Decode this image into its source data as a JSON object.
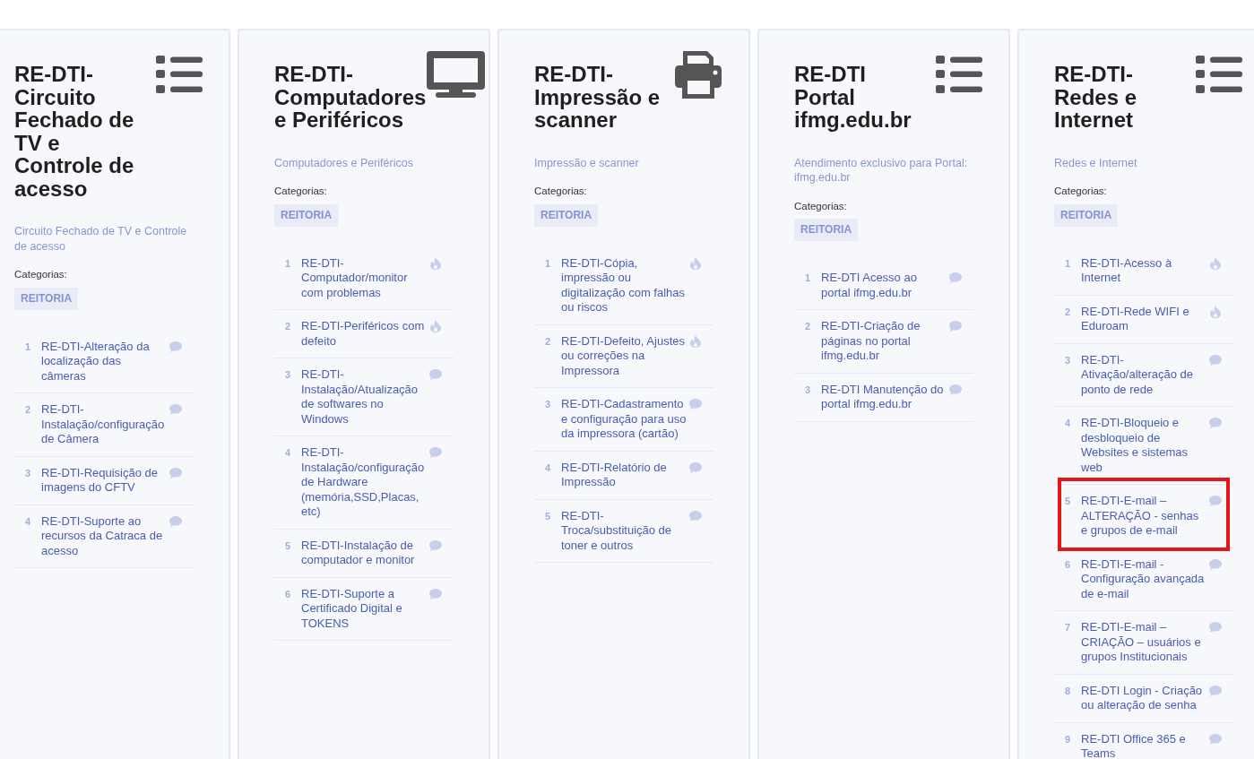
{
  "cards": [
    {
      "kind": "list",
      "title": "RE-DTI-Circuito Fechado de TV e Controle de acesso",
      "description": "Circuito Fechado de TV e Controle de acesso",
      "categories_label": "Categorias:",
      "categories": [
        "REITORIA"
      ],
      "items": [
        {
          "number": "1",
          "title": "RE-DTI-Alteração da localização das câmeras",
          "kind": "comment",
          "highlighted": false
        },
        {
          "number": "2",
          "title": "RE-DTI-Instalação/configuração de Câmera",
          "kind": "comment",
          "highlighted": false
        },
        {
          "number": "3",
          "title": "RE-DTI-Requisição de imagens do CFTV",
          "kind": "comment",
          "highlighted": false
        },
        {
          "number": "4",
          "title": "RE-DTI-Suporte ao recursos da Catraca de acesso",
          "kind": "comment",
          "highlighted": false
        }
      ]
    },
    {
      "kind": "monitor",
      "title": "RE-DTI-Computadores e Periféricos",
      "description": "Computadores e Periféricos",
      "categories_label": "Categorias:",
      "categories": [
        "REITORIA"
      ],
      "items": [
        {
          "number": "1",
          "title": "RE-DTI-Computador/monitor com problemas",
          "kind": "flame",
          "highlighted": false
        },
        {
          "number": "2",
          "title": "RE-DTI-Periféricos com defeito",
          "kind": "flame",
          "highlighted": false
        },
        {
          "number": "3",
          "title": "RE-DTI-Instalação/Atualização de softwares no Windows",
          "kind": "comment",
          "highlighted": false
        },
        {
          "number": "4",
          "title": "RE-DTI-Instalação/configuração de Hardware (memória,SSD,Placas, etc)",
          "kind": "comment",
          "highlighted": false
        },
        {
          "number": "5",
          "title": "RE-DTI-Instalação de computador e monitor",
          "kind": "comment",
          "highlighted": false
        },
        {
          "number": "6",
          "title": "RE-DTI-Suporte a Certificado Digital e TOKENS",
          "kind": "comment",
          "highlighted": false
        }
      ]
    },
    {
      "kind": "printer",
      "title": "RE-DTI-Impressão e scanner",
      "description": "Impressão e scanner",
      "categories_label": "Categorias:",
      "categories": [
        "REITORIA"
      ],
      "items": [
        {
          "number": "1",
          "title": "RE-DTI-Cópia, impressão ou digitalização com falhas ou riscos",
          "kind": "flame",
          "highlighted": false
        },
        {
          "number": "2",
          "title": "RE-DTI-Defeito, Ajustes ou correções na Impressora",
          "kind": "flame",
          "highlighted": false
        },
        {
          "number": "3",
          "title": "RE-DTI-Cadastramento e configuração para uso da impressora (cartão)",
          "kind": "comment",
          "highlighted": false
        },
        {
          "number": "4",
          "title": "RE-DTI-Relatório de Impressão",
          "kind": "comment",
          "highlighted": false
        },
        {
          "number": "5",
          "title": "RE-DTI-Troca/substituição de toner e outros",
          "kind": "comment",
          "highlighted": false
        }
      ]
    },
    {
      "kind": "list",
      "title": "RE-DTI Portal ifmg.edu.br",
      "description": "Atendimento exclusivo para Portal: ifmg.edu.br",
      "categories_label": "Categorias:",
      "categories": [
        "REITORIA"
      ],
      "items": [
        {
          "number": "1",
          "title": "RE-DTI Acesso ao portal ifmg.edu.br",
          "kind": "comment",
          "highlighted": false
        },
        {
          "number": "2",
          "title": "RE-DTI-Criação de páginas no portal ifmg.edu.br",
          "kind": "comment",
          "highlighted": false
        },
        {
          "number": "3",
          "title": "RE-DTI Manutenção do portal ifmg.edu.br",
          "kind": "comment",
          "highlighted": false
        }
      ]
    },
    {
      "kind": "list",
      "title": "RE-DTI-Redes e Internet",
      "description": "Redes e Internet",
      "categories_label": "Categorias:",
      "categories": [
        "REITORIA"
      ],
      "items": [
        {
          "number": "1",
          "title": "RE-DTI-Acesso à Internet",
          "kind": "flame",
          "highlighted": false
        },
        {
          "number": "2",
          "title": "RE-DTI-Rede WIFI e Eduroam",
          "kind": "flame",
          "highlighted": false
        },
        {
          "number": "3",
          "title": "RE-DTI-Ativação/alteração de ponto de rede",
          "kind": "comment",
          "highlighted": false
        },
        {
          "number": "4",
          "title": "RE-DTI-Bloqueio e desbloqueio de Websites e sistemas web",
          "kind": "comment",
          "highlighted": false
        },
        {
          "number": "5",
          "title": "RE-DTI-E-mail – ALTERAÇÃO - senhas e grupos de e-mail",
          "kind": "comment",
          "highlighted": true
        },
        {
          "number": "6",
          "title": "RE-DTI-E-mail - Configuração avançada de e-mail",
          "kind": "comment",
          "highlighted": false
        },
        {
          "number": "7",
          "title": "RE-DTI-E-mail – CRIAÇÃO – usuários e grupos Institucionais",
          "kind": "comment",
          "highlighted": false
        },
        {
          "number": "8",
          "title": "RE-DTI Login - Criação ou alteração de senha",
          "kind": "comment",
          "highlighted": false
        },
        {
          "number": "9",
          "title": "RE-DTI Office 365 e Teams",
          "kind": "comment",
          "highlighted": false
        }
      ]
    }
  ]
}
